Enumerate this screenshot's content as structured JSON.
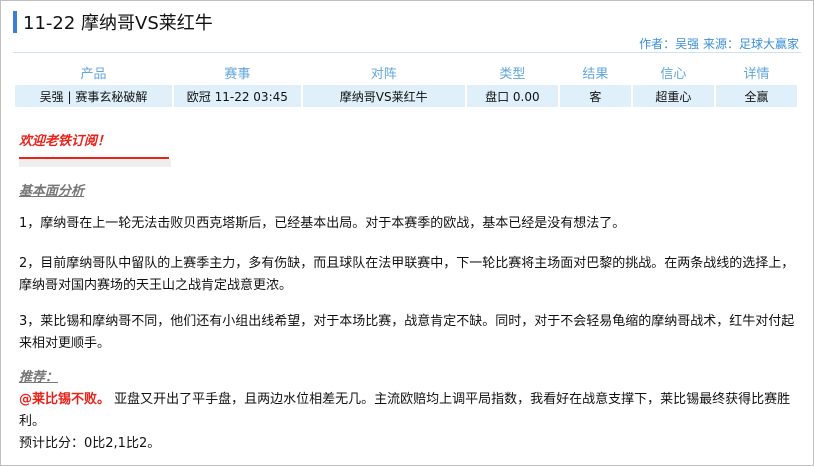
{
  "header": {
    "title": "11-22   摩纳哥VS莱红牛",
    "author_label": "作者：",
    "author": "吴强",
    "source_label": "来源：",
    "source": "足球大赢家"
  },
  "table": {
    "headers": [
      "产品",
      "赛事",
      "对阵",
      "类型",
      "结果",
      "信心",
      "详情"
    ],
    "row": [
      "吴强 | 赛事玄秘破解",
      "欧冠 11-22 03:45",
      "摩纳哥VS莱红牛",
      "盘口 0.00",
      "客",
      "超重心",
      "全赢"
    ]
  },
  "article": {
    "welcome": "欢迎老铁订阅！",
    "section_title": "基本面分析",
    "p1": "1，摩纳哥在上一轮无法击败贝西克塔斯后，已经基本出局。对于本赛季的欧战，基本已经是没有想法了。",
    "p2": "2，目前摩纳哥队中留队的上赛季主力，多有伤缺，而且球队在法甲联赛中，下一轮比赛将主场面对巴黎的挑战。在两条战线的选择上，摩纳哥对国内赛场的天王山之战肯定战意更浓。",
    "p3": "3，莱比锡和摩纳哥不同，他们还有小组出线希望，对于本场比赛，战意肯定不缺。同时，对于不会轻易龟缩的摩纳哥战术，红牛对付起来相对更顺手。",
    "rec_title": "推荐：",
    "rec_pick": "@莱比锡不败。",
    "rec_text": " 亚盘又开出了平手盘，且两边水位相差无几。主流欧赔均上调平局指数，我看好在战意支撑下，莱比锡最终获得比赛胜利。",
    "score": "预计比分：0比2,1比2。"
  },
  "colors": {
    "accent": "#3b7fd6",
    "link": "#3b8fd8",
    "highlight": "#e8231a",
    "row_bg": "#dff0fb"
  }
}
